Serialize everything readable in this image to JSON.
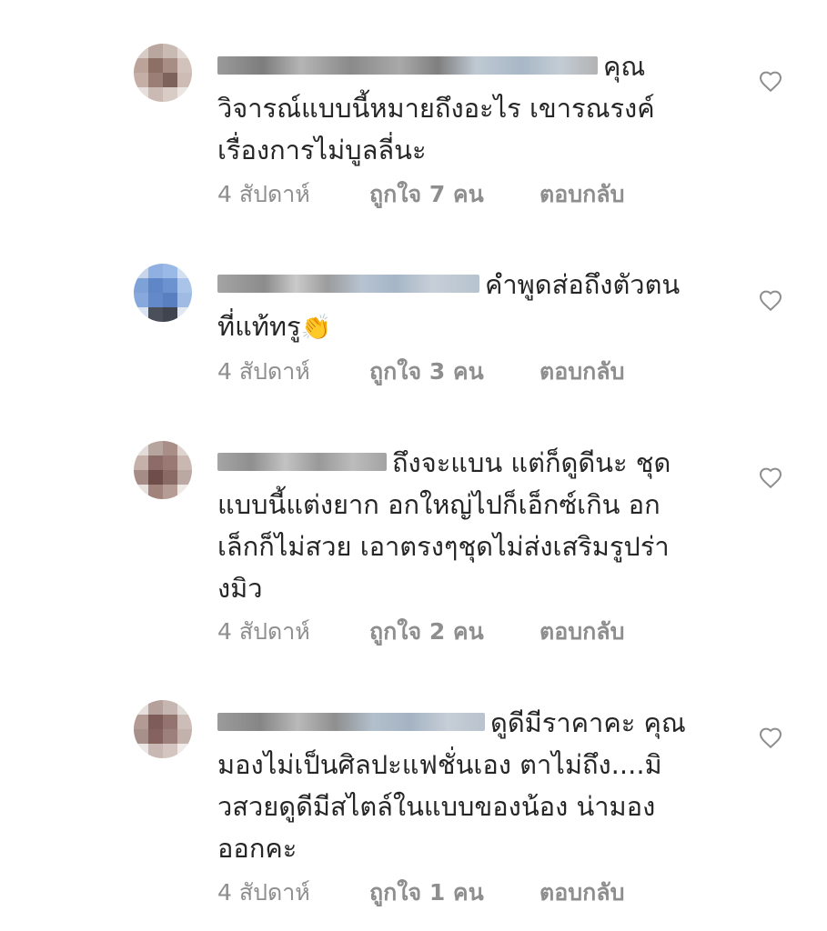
{
  "comments": [
    {
      "lines": [
        "คุณ",
        "วิจารณ์แบบนี้หมายถึงอะไร เขารณรงค์",
        "เรื่องการไม่บูลลี่นะ"
      ],
      "time": "4 สัปดาห์",
      "likes": "ถูกใจ 7 คน",
      "reply": "ตอบกลับ"
    },
    {
      "lines": [
        "คำพูดส่อถึงตัวตน",
        "ที่แท้ทรู"
      ],
      "emoji": "👏",
      "time": "4 สัปดาห์",
      "likes": "ถูกใจ 3 คน",
      "reply": "ตอบกลับ"
    },
    {
      "lines": [
        "ถึงจะแบน แต่ก็ดูดีนะ ชุด",
        "แบบนี้แต่งยาก อกใหญ่ไปก็เอ็กซ์เกิน อก",
        "เล็กก็ไม่สวย เอาตรงๆชุดไม่ส่งเสริมรูปร่า",
        "งมิว"
      ],
      "time": "4 สัปดาห์",
      "likes": "ถูกใจ 2 คน",
      "reply": "ตอบกลับ"
    },
    {
      "lines": [
        "ดูดีมีราคาคะ คุณ",
        "มองไม่เป็นศิลปะแฟชั่นเอง ตาไม่ถึง....มิ",
        "วสวยดูดีมีสไตล์ในแบบของน้อง น่ามอง",
        "ออกคะ"
      ],
      "time": "4 สัปดาห์",
      "likes": "ถูกใจ 1 คน",
      "reply": "ตอบกลับ"
    }
  ],
  "icons": {
    "like": "heart-outline-icon"
  },
  "colors": {
    "text": "#262626",
    "meta": "#8e8e8e",
    "heart": "#8e8e8e"
  }
}
